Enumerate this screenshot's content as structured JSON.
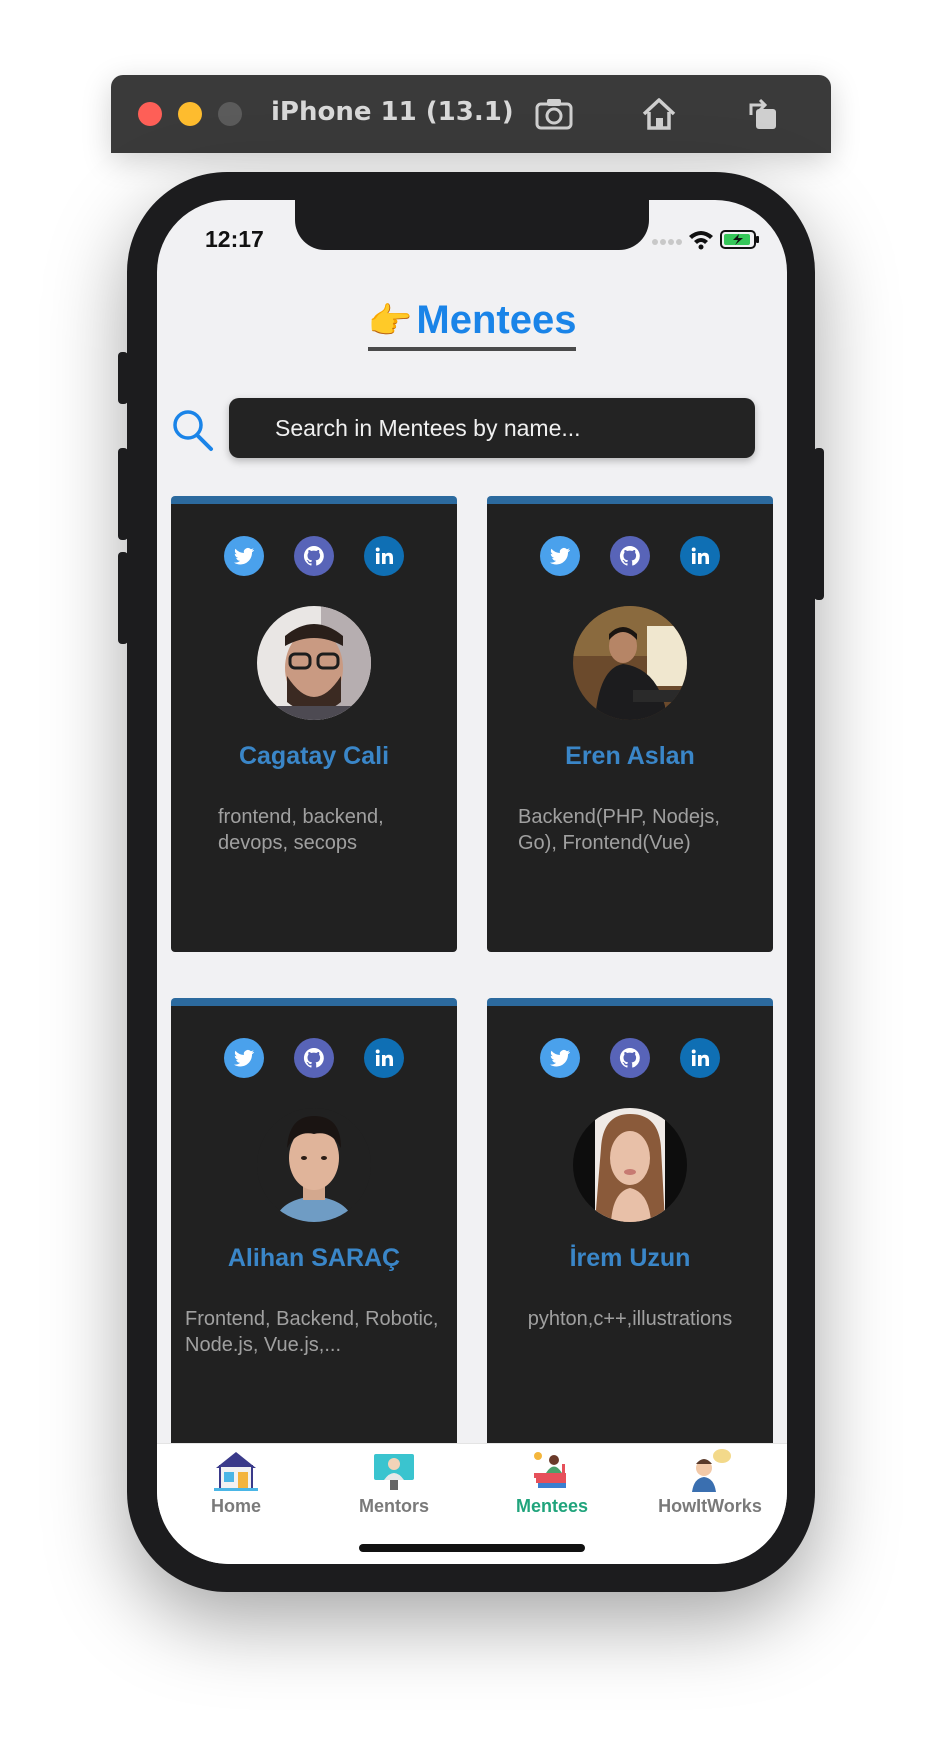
{
  "simulator": {
    "title": "iPhone 11 (13.1)",
    "buttons": [
      "screenshot-icon",
      "home-icon",
      "rotate-icon"
    ]
  },
  "status_bar": {
    "time": "12:17"
  },
  "page": {
    "title_emoji": "👉",
    "title": "Mentees",
    "search_placeholder": "Search in Mentees by name..."
  },
  "mentees": [
    {
      "name": "Cagatay Cali",
      "skills": "frontend, backend, devops, secops"
    },
    {
      "name": "Eren Aslan",
      "skills": "Backend(PHP, Nodejs, Go), Frontend(Vue)"
    },
    {
      "name": "Alihan SARAÇ",
      "skills": "Frontend, Backend, Robotic, Node.js, Vue.js,..."
    },
    {
      "name": "İrem Uzun",
      "skills": "pyhton,c++,illustrations"
    }
  ],
  "tabs": [
    {
      "label": "Home",
      "icon": "house-icon"
    },
    {
      "label": "Mentors",
      "icon": "mentor-icon"
    },
    {
      "label": "Mentees",
      "icon": "mentee-books-icon",
      "active": true
    },
    {
      "label": "HowItWorks",
      "icon": "person-speech-icon"
    }
  ],
  "colors": {
    "accent": "#1a84e8",
    "card": "#212121",
    "card_top": "#2c6a9e",
    "name": "#3a86c8",
    "active_tab": "#20a47c"
  }
}
